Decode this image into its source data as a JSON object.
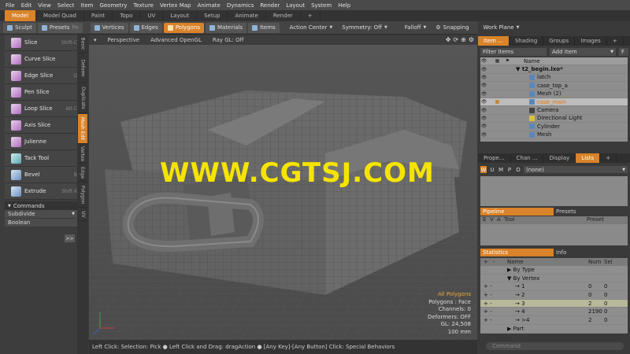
{
  "menu": [
    "File",
    "Edit",
    "View",
    "Select",
    "Item",
    "Geometry",
    "Texture",
    "Vertex Map",
    "Animate",
    "Dynamics",
    "Render",
    "Layout",
    "System",
    "Help"
  ],
  "layout_tabs": [
    {
      "label": "Model",
      "active": true
    },
    {
      "label": "Model Quad"
    },
    {
      "label": "Paint"
    },
    {
      "label": "Topo"
    },
    {
      "label": "UV"
    },
    {
      "label": "Layout"
    },
    {
      "label": "Setup"
    },
    {
      "label": "Animate"
    },
    {
      "label": "Render"
    },
    {
      "label": "+"
    }
  ],
  "toolbar": {
    "sculpt": "Sculpt",
    "presets": "Presets",
    "presets_extra": "Pe",
    "vertices": "Vertices",
    "edges": "Edges",
    "polygons": "Polygons",
    "materials": "Materials",
    "items": "Items",
    "action_center": "Action Center",
    "symmetry": "Symmetry: Off",
    "falloff": "Falloff",
    "snapping": "Snapping",
    "work_plane": "Work Plane"
  },
  "tools": [
    {
      "name": "Slice",
      "key": "Shift-C"
    },
    {
      "name": "Curve Slice",
      "key": ""
    },
    {
      "name": "Edge Slice",
      "key": "Q"
    },
    {
      "name": "Pen Slice",
      "key": ""
    },
    {
      "name": "Loop Slice",
      "key": "Alt-C"
    },
    {
      "name": "Axis Slice",
      "key": ""
    },
    {
      "name": "Julienne",
      "key": ""
    },
    {
      "name": "Tack Tool",
      "key": ""
    },
    {
      "name": "Bevel",
      "key": "B"
    },
    {
      "name": "Extrude",
      "key": "Shift-X"
    }
  ],
  "commands": {
    "head": "Commands",
    "subdivide": "Subdivide",
    "boolean": "Boolean",
    "more": ">>"
  },
  "vertical_tabs": [
    "Basic",
    "Deform",
    "Duplicate",
    "Mesh Edit",
    "Vertex",
    "Edge",
    "Polygon",
    "UV"
  ],
  "viewport": {
    "perspective": "Perspective",
    "shading": "Advanced OpenGL",
    "raygl": "Ray GL: Off",
    "watermark": "WWW.CGTSJ.COM",
    "info": [
      "All Polygons",
      "Polygons : Face",
      "Channels: 0",
      "Deformers: OFF",
      "GL: 24,508",
      "100 mm"
    ]
  },
  "statusbar": "Left Click: Selection: Pick ● Left Click and Drag: dragAction ● [Any Key]-[Any Button] Click: Special Behaviors",
  "right": {
    "tabs": [
      "Item ...",
      "Shading",
      "Groups",
      "Images",
      "+"
    ],
    "filter": "Filter Items",
    "add_item": "Add Item",
    "f": "F",
    "tree_header": "Name",
    "tree": [
      {
        "name": "t2_begin.lxo*",
        "depth": 0,
        "bold": true
      },
      {
        "name": "latch",
        "depth": 2
      },
      {
        "name": "case_top_a",
        "depth": 2
      },
      {
        "name": "Mesh (2)",
        "depth": 2
      },
      {
        "name": "case_main",
        "depth": 2,
        "selected": true
      },
      {
        "name": "Camera",
        "depth": 2
      },
      {
        "name": "Directional Light",
        "depth": 2
      },
      {
        "name": "Cylinder",
        "depth": 2
      },
      {
        "name": "Mesh",
        "depth": 2
      }
    ],
    "prop_tabs": [
      "Prope...",
      "Chan ...",
      "Display",
      "Lists",
      "+"
    ],
    "prop_letters": [
      "W",
      "U",
      "M",
      "P",
      "O"
    ],
    "prop_value": "(none)",
    "pipe_tabs": [
      "Pipeline",
      "Presets"
    ],
    "pipe_cols": [
      "E",
      "V",
      "A",
      "Tool",
      "Preset"
    ],
    "stats_tabs": [
      "Statistics",
      "Info"
    ],
    "stats_cols": [
      "+",
      "-",
      "Name",
      "Num",
      "Sel"
    ],
    "stats": [
      {
        "pm": "",
        "name": "▶  By Type",
        "num": "",
        "sel": ""
      },
      {
        "pm": "",
        "name": "▼  By Vertex",
        "num": "",
        "sel": ""
      },
      {
        "pm": "+  -",
        "name": "→  1",
        "num": "0",
        "sel": "0"
      },
      {
        "pm": "+  -",
        "name": "→  2",
        "num": "0",
        "sel": "0"
      },
      {
        "pm": "+  -",
        "name": "→  3",
        "num": "2",
        "sel": "0",
        "hl": true
      },
      {
        "pm": "+  -",
        "name": "→  4",
        "num": "2190",
        "sel": "0"
      },
      {
        "pm": "+  -",
        "name": "→  >4",
        "num": "2",
        "sel": "0"
      },
      {
        "pm": "",
        "name": "▶  Part",
        "num": "",
        "sel": ""
      }
    ],
    "command_placeholder": "Command"
  }
}
